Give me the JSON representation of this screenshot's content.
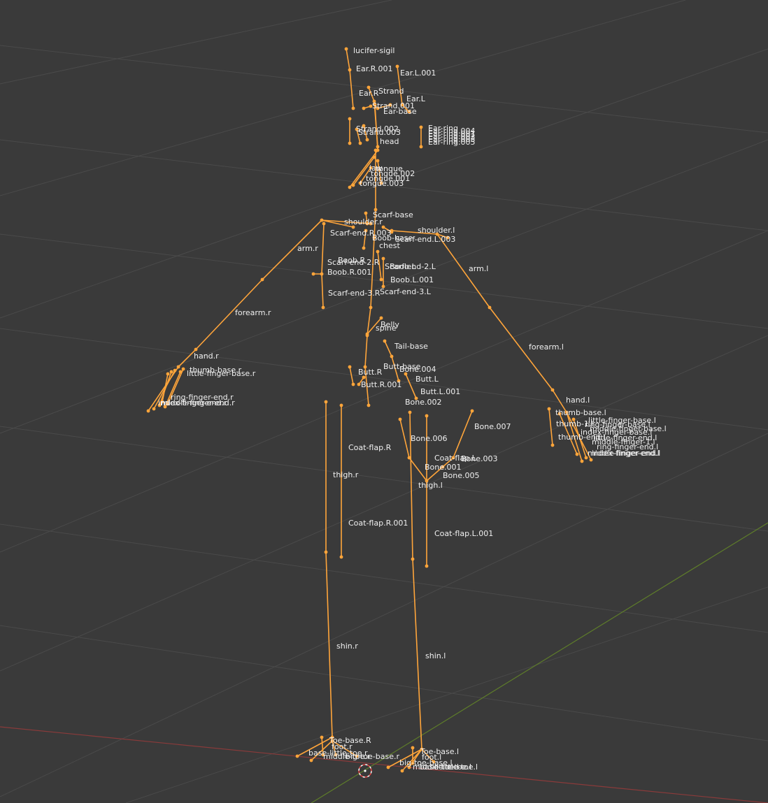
{
  "viewport": {
    "name": "3D Viewport",
    "colors": {
      "background": "#3a3a3a",
      "grid": "#4a4a4a",
      "bone": "#ffa53a",
      "label": "#f0f0f0",
      "x_axis": "#8a3a3a",
      "y_axis": "#5e7d2a",
      "cursor": "#e04040"
    }
  },
  "bone_labels": [
    "lucifer-sigil",
    "Ear.R.001",
    "Ear.L.001",
    "Ear.R",
    "Strand",
    "Ear.L",
    "Strand.001",
    "Ear-base",
    "Strand.002",
    "Strand.003",
    "Ear-ring",
    "Ear-ring.004",
    "Ear-ring.001",
    "Ear-ring.002",
    "Ear-ring.003",
    "Ear-ring.005",
    "head",
    "jaw",
    "tongue",
    "tongue.002",
    "tongue.001",
    "tongue.003",
    "Scarf-base",
    "shoulder.r",
    "Scarf-end.R.003",
    "shoulder.l",
    "Boob-base",
    "Scarf-end.L.003",
    "chest",
    "arm.r",
    "Boob.R",
    "Scarf-end-2.R",
    "Boob.L",
    "Scarf-end-2.L",
    "Boob.R.001",
    "Boob.L.001",
    "arm.l",
    "Scarf-end-3.R",
    "Scarf-end-3.L",
    "forearm.r",
    "Belly",
    "spine",
    "Tail-base",
    "forearm.l",
    "hand.r",
    "Butt-base",
    "Bone.004",
    "thumb-base.r",
    "little-finger-base.r",
    "Butt.R",
    "Butt.L",
    "Butt.R.001",
    "Butt.L.001",
    "hand.l",
    "Bone.002",
    "thumb-base.l",
    "little-finger-base.l",
    "ring-finger-base.l",
    "middle-finger-base.l",
    "index-finger-base.l",
    "little-finger-end.l",
    "thumb-1.l",
    "Bone.007",
    "thumb-end.l",
    "middle-finger-1.l",
    "ring-finger-end.l",
    "index-finger-end.l",
    "middle-finger-end.l",
    "ring-finger-end.r",
    "index-finger-end.r",
    "middle-finger-end.r",
    "Coat-flap.R",
    "Bone.006",
    "Coat-flap.L",
    "Bone.003",
    "Bone.001",
    "Bone.005",
    "thigh.r",
    "thigh.l",
    "Coat-flap.R.001",
    "Coat-flap.L.001",
    "shin.r",
    "shin.l",
    "Toe-base.R",
    "foot.r",
    "base-little-toe.r",
    "middle-toe.r",
    "big-toe-base.r",
    "Toe-base.l",
    "foot.l",
    "big-toe-base.l",
    "middle-toe.l",
    "little-toe.l",
    "base-little-toe.l"
  ]
}
